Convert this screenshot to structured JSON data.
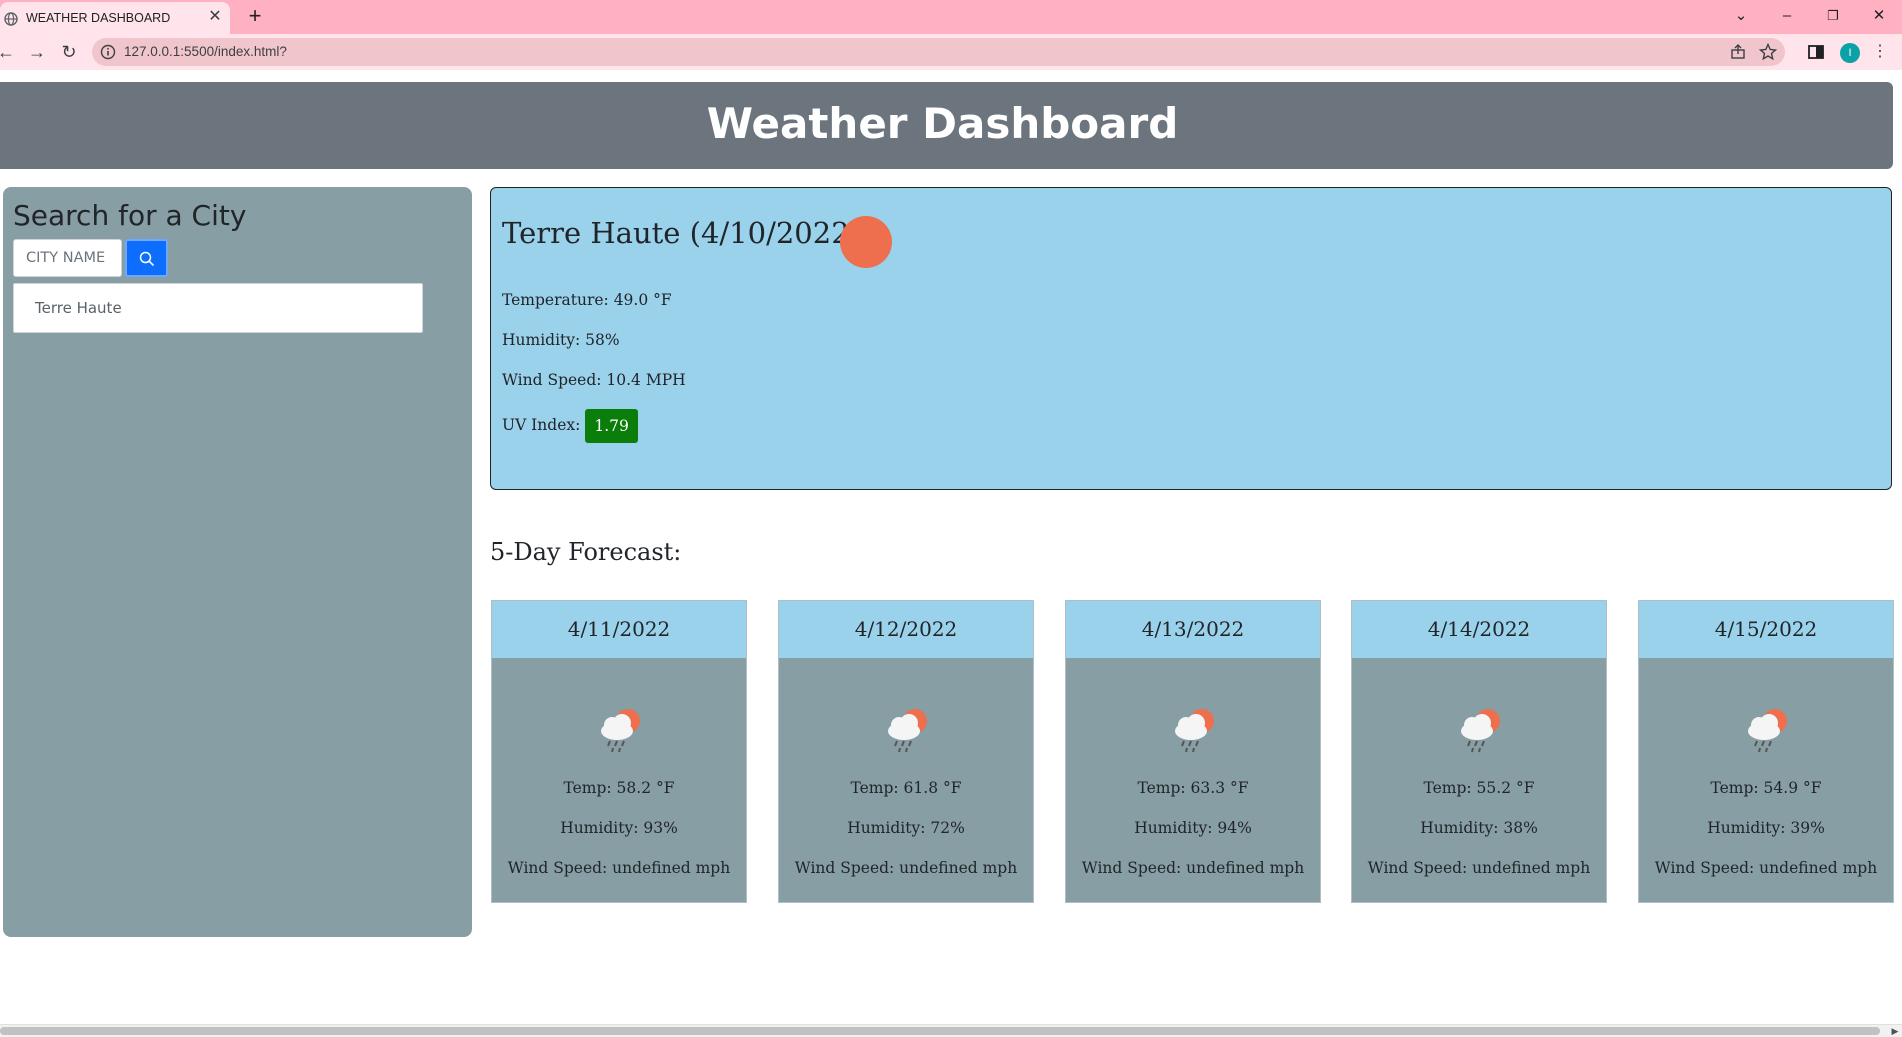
{
  "browser": {
    "tab_title": "WEATHER DASHBOARD",
    "url": "127.0.0.1:5500/index.html?",
    "profile_initial": "I"
  },
  "header": {
    "title": "Weather Dashboard"
  },
  "sidebar": {
    "heading": "Search for a City",
    "search_placeholder": "CITY NAME",
    "history": [
      "Terre Haute"
    ]
  },
  "current": {
    "title": "Terre Haute (4/10/2022)",
    "temperature": "Temperature: 49.0 °F",
    "humidity": "Humidity: 58%",
    "wind": "Wind Speed: 10.4 MPH",
    "uv_label": "UV Index:",
    "uv_value": "1.79",
    "uv_color": "#0a7d0a",
    "icon_color": "#ed6f4e"
  },
  "forecast": {
    "heading": "5-Day Forecast:",
    "days": [
      {
        "date": "4/11/2022",
        "temp": "Temp: 58.2 °F",
        "humidity": "Humidity: 93%",
        "wind": "Wind Speed: undefined mph",
        "icon": "rain-cloud-sun-icon"
      },
      {
        "date": "4/12/2022",
        "temp": "Temp: 61.8 °F",
        "humidity": "Humidity: 72%",
        "wind": "Wind Speed: undefined mph",
        "icon": "rain-cloud-sun-icon"
      },
      {
        "date": "4/13/2022",
        "temp": "Temp: 63.3 °F",
        "humidity": "Humidity: 94%",
        "wind": "Wind Speed: undefined mph",
        "icon": "rain-cloud-sun-icon"
      },
      {
        "date": "4/14/2022",
        "temp": "Temp: 55.2 °F",
        "humidity": "Humidity: 38%",
        "wind": "Wind Speed: undefined mph",
        "icon": "rain-cloud-sun-icon"
      },
      {
        "date": "4/15/2022",
        "temp": "Temp: 54.9 °F",
        "humidity": "Humidity: 39%",
        "wind": "Wind Speed: undefined mph",
        "icon": "rain-cloud-sun-icon"
      }
    ]
  },
  "colors": {
    "header_bg": "#6c757d",
    "sidebar_bg": "#879ea5",
    "current_bg": "#9ad1eb",
    "search_button": "#0d6efd"
  }
}
